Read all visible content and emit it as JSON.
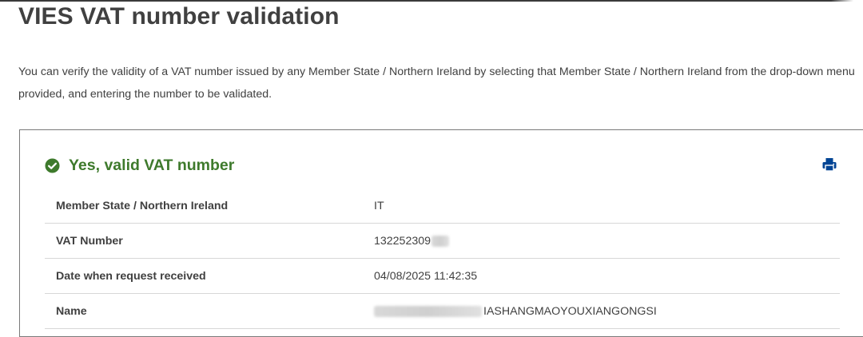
{
  "page": {
    "title": "VIES VAT number validation",
    "intro": "You can verify the validity of a VAT number issued by any Member State / Northern Ireland by selecting that Member State / Northern Ireland from the drop-down menu provided, and entering the number to be validated."
  },
  "result": {
    "status_text": "Yes, valid VAT number",
    "status_icon": "check-circle-icon",
    "status_color": "#3e7a2c",
    "print_icon": "print-icon",
    "print_color": "#004494",
    "rows": [
      {
        "label": "Member State / Northern Ireland",
        "value": "IT"
      },
      {
        "label": "VAT Number",
        "value": "132252309"
      },
      {
        "label": "Date when request received",
        "value": "04/08/2025 11:42:35"
      },
      {
        "label": "Name",
        "value": "IASHANGMAOYOUXIANGONGSI"
      }
    ]
  }
}
